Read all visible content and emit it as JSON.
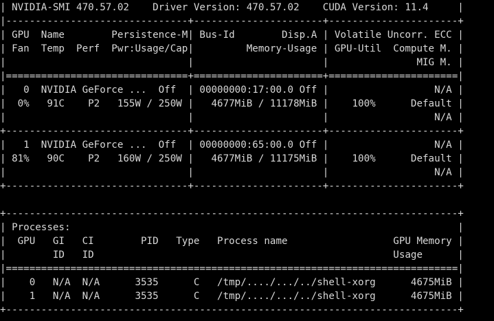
{
  "terminal": {
    "colors": {
      "background": "#000000",
      "foreground": "#d8d8d8"
    },
    "lines": [
      "| NVIDIA-SMI 470.57.02    Driver Version: 470.57.02    CUDA Version: 11.4     |",
      "|-------------------------------+----------------------+----------------------+",
      "| GPU  Name        Persistence-M| Bus-Id        Disp.A | Volatile Uncorr. ECC |",
      "| Fan  Temp  Perf  Pwr:Usage/Cap|         Memory-Usage | GPU-Util  Compute M. |",
      "|                               |                      |               MIG M. |",
      "|===============================+======================+======================|",
      "|   0  NVIDIA GeForce ...  Off  | 00000000:17:00.0 Off |                  N/A |",
      "|  0%   91C    P2   155W / 250W |   4677MiB / 11178MiB |    100%      Default |",
      "|                               |                      |                  N/A |",
      "+-------------------------------+----------------------+----------------------+",
      "|   1  NVIDIA GeForce ...  Off  | 00000000:65:00.0 Off |                  N/A |",
      "| 81%   90C    P2   160W / 250W |   4677MiB / 11175MiB |    100%      Default |",
      "|                               |                      |                  N/A |",
      "+-------------------------------+----------------------+----------------------+",
      "",
      "+-----------------------------------------------------------------------------+",
      "| Processes:                                                                  |",
      "|  GPU   GI   CI        PID   Type   Process name                  GPU Memory |",
      "|        ID   ID                                                   Usage      |",
      "|=============================================================================|",
      "|    0   N/A  N/A      3535      C   /tmp/..../.../../shell-xorg      4675MiB |",
      "|    1   N/A  N/A      3535      C   /tmp/..../.../../shell-xorg      4675MiB |",
      "+-----------------------------------------------------------------------------+"
    ]
  }
}
